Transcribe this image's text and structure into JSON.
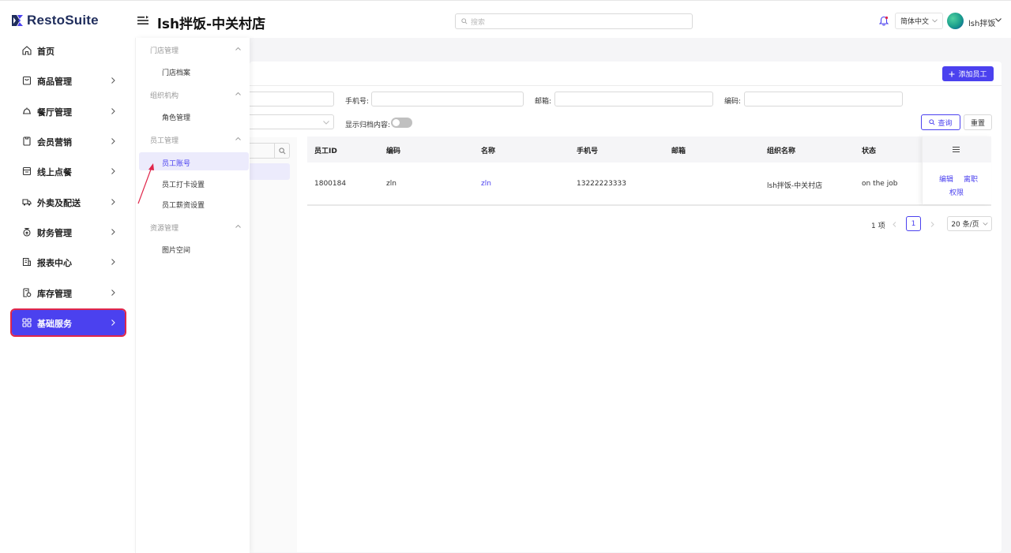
{
  "header": {
    "brand": "RestoSuite",
    "store_title": "lsh拌饭-中关村店",
    "search_placeholder": "搜索",
    "language": "简体中文",
    "user_name": "lsh拌饭"
  },
  "sidebar": {
    "items": [
      {
        "label": "首页",
        "icon": "home-icon"
      },
      {
        "label": "商品管理",
        "icon": "bag-icon"
      },
      {
        "label": "餐厅管理",
        "icon": "restaurant-icon"
      },
      {
        "label": "会员营销",
        "icon": "member-card-icon"
      },
      {
        "label": "线上点餐",
        "icon": "online-order-icon"
      },
      {
        "label": "外卖及配送",
        "icon": "delivery-truck-icon"
      },
      {
        "label": "财务管理",
        "icon": "finance-icon"
      },
      {
        "label": "报表中心",
        "icon": "report-icon"
      },
      {
        "label": "库存管理",
        "icon": "inventory-icon"
      },
      {
        "label": "基础服务",
        "icon": "grid-icon",
        "active": true
      }
    ]
  },
  "submenu": {
    "groups": [
      {
        "title": "门店管理",
        "items": [
          "门店档案"
        ]
      },
      {
        "title": "组织机构",
        "items": [
          "角色管理"
        ]
      },
      {
        "title": "员工管理",
        "items": [
          "员工账号",
          "员工打卡设置",
          "员工薪资设置"
        ],
        "active_item": "员工账号"
      },
      {
        "title": "资源管理",
        "items": [
          "图片空间"
        ]
      }
    ]
  },
  "toolbar": {
    "add_button": "添加员工"
  },
  "filters": {
    "phone_label": "手机号:",
    "email_label": "邮箱:",
    "code_label": "编码:",
    "show_archived_label": "显示归档内容:",
    "show_archived": false,
    "query_button": "查询",
    "reset_button": "重置"
  },
  "table": {
    "columns": [
      "员工ID",
      "编码",
      "名称",
      "手机号",
      "邮箱",
      "组织名称",
      "状态"
    ],
    "rows": [
      {
        "id": "1800184",
        "code": "zln",
        "name": "zln",
        "phone": "13222223333",
        "email": "",
        "org": "lsh拌饭-中关村店",
        "status": "on the job",
        "actions": [
          "编辑",
          "离职",
          "权限"
        ]
      }
    ]
  },
  "pagination": {
    "total": "1 项",
    "current_page": "1",
    "page_size": "20 条/页"
  },
  "colors": {
    "accent": "#4b41ef",
    "highlight_border": "#e0264a",
    "annotation_arrow": "#e0264a"
  }
}
